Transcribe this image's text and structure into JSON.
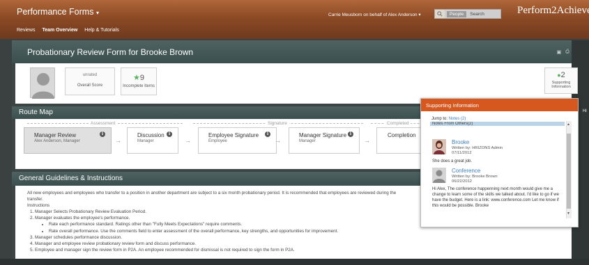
{
  "topbar": {
    "brand": "Performance Forms",
    "nav": [
      "Reviews",
      "Team Overview",
      "Help & Tutorials"
    ],
    "behalf": "Carrie Meusborn on behalf of Alex Anderson",
    "search_scope": "People",
    "search_placeholder": "Search",
    "logo": "Perform2Achieve"
  },
  "form": {
    "title": "Probationary Review Form for Brooke Brown",
    "overall_score_value": "unrated",
    "overall_score_label": "Overall Score",
    "incomplete_count": "9",
    "incomplete_label": "Incomplete Items",
    "supporting_count": "2",
    "supporting_label_1": "Supporting",
    "supporting_label_2": "Information"
  },
  "route_map": {
    "title": "Route Map",
    "phases": [
      "Assessment",
      "Signature",
      "Completed"
    ],
    "steps": [
      {
        "name": "Manager Review",
        "who": "Alex Anderson, Manager"
      },
      {
        "name": "Discussion",
        "who": "Manager"
      },
      {
        "name": "Employee Signature",
        "who": "Employee"
      },
      {
        "name": "Manager Signature",
        "who": "Manager"
      },
      {
        "name": "Completion",
        "who": ""
      }
    ]
  },
  "guidelines": {
    "title": "General Guidelines & Instructions",
    "intro": "All new employees and employees who transfer to a position in another department are subject to a six month probationary period. It is recommended that employees are reviewed during the",
    "intro_cont": "transfer.",
    "instructions_label": "Instructions",
    "items": [
      "Manager Selects Probationary Review Evaluation Period.",
      "Manager evaluates the employee's performance.",
      "Manager schedules performance discussion.",
      "Manager and employee review probationary review form and discuss performance.",
      "Employee and manager sign the review form in P2A. An employee recommended for dismissal is not required to sign the form in P2A."
    ],
    "subitems": [
      "Rate each performance standard. Ratings other than \"Fully Meets Expectations\" require comments.",
      "Rate overall performance. Use the comments field to enter assessment of the overall performance, key strengths, and opportunities for improvement."
    ]
  },
  "sidebar": {
    "hi_tab": "Hi"
  },
  "popup": {
    "title": "Supporting Information",
    "jump_label": "Jump to:",
    "jump_link": "Notes (2)",
    "notes_bar": "Notes From Others(2)",
    "notes": [
      {
        "title": "Brooke",
        "by": "Written by: HRIZONS Admin",
        "date": "07/11/2012",
        "text": "She does a great job."
      },
      {
        "title": "Conference",
        "by": "Written by: Brooke Brown",
        "date": "06/22/2012",
        "text": "Hi Alex, The conference happenning next month would give me a change to learn some of the skills we talked about. I'd like to go if we have the budget. Here is a link: www.conference.com Let me know if this would be possible. Brooke"
      }
    ]
  },
  "colors": {
    "topbar": "#8c4a25",
    "section_header": "#44595a",
    "popup_header": "#d6581f",
    "accent_green": "#5bb363",
    "link": "#3f7fbf"
  }
}
